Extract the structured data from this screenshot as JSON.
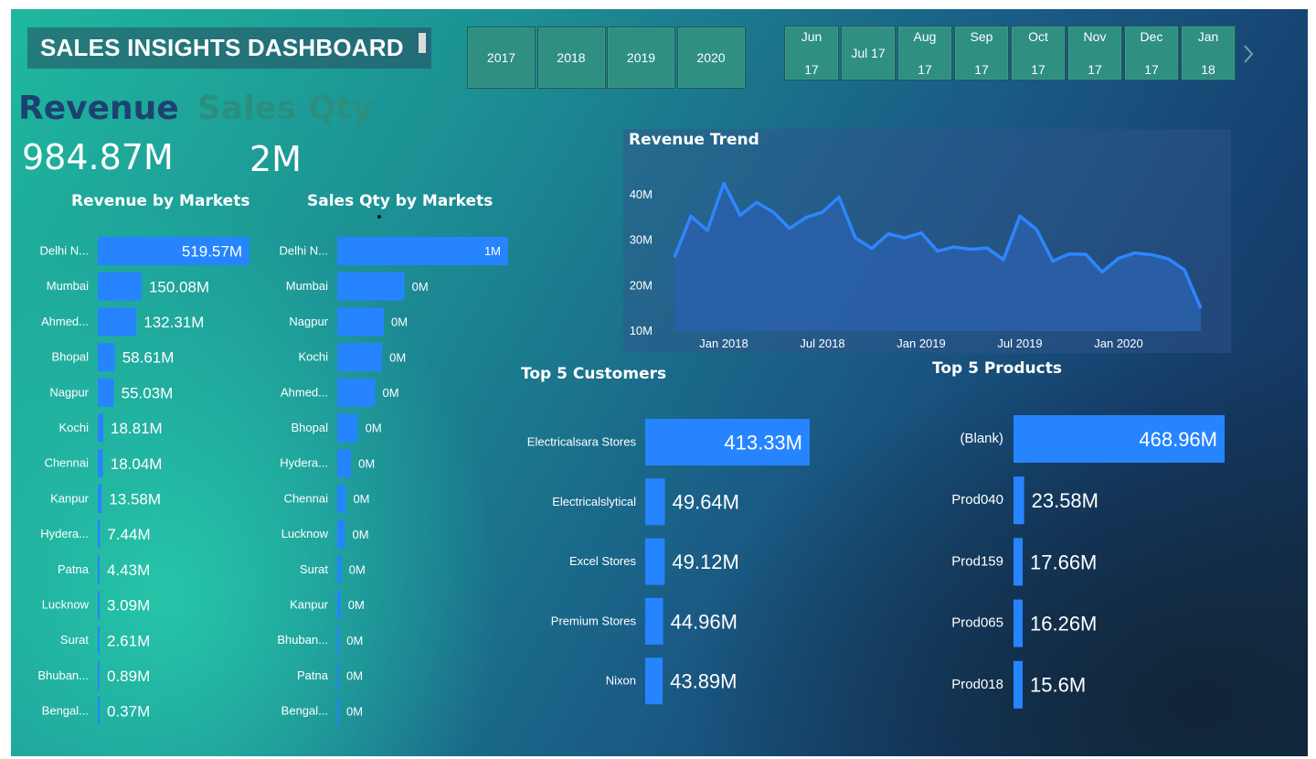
{
  "title": "SALES INSIGHTS DASHBOARD",
  "year_slicer": [
    "2017",
    "2018",
    "2019",
    "2020"
  ],
  "month_slicer": [
    "Jun 17",
    "Jul 17",
    "Aug 17",
    "Sep 17",
    "Oct 17",
    "Nov 17",
    "Dec 17",
    "Jan 18"
  ],
  "kpis": {
    "revenue_label": "Revenue",
    "revenue_value": "984.87M",
    "qty_label": "Sales Qty",
    "qty_value": "2M"
  },
  "colors": {
    "bar": "#2684ff",
    "revenue_label": "#1c4272",
    "qty_label": "#2b8f80",
    "line": "#2e86ff",
    "area": "#2a5fa8"
  },
  "icons": {
    "month_next": "chevron-right-icon"
  },
  "chart_data": [
    {
      "type": "bar",
      "orientation": "horizontal",
      "title": "Revenue by Markets",
      "categories": [
        "Delhi N...",
        "Mumbai",
        "Ahmed...",
        "Bhopal",
        "Nagpur",
        "Kochi",
        "Chennai",
        "Kanpur",
        "Hydera...",
        "Patna",
        "Lucknow",
        "Surat",
        "Bhuban...",
        "Bengal..."
      ],
      "values": [
        519.57,
        150.08,
        132.31,
        58.61,
        55.03,
        18.81,
        18.04,
        13.58,
        7.44,
        4.43,
        3.09,
        2.61,
        0.89,
        0.37
      ],
      "labels": [
        "519.57M",
        "150.08M",
        "132.31M",
        "58.61M",
        "55.03M",
        "18.81M",
        "18.04M",
        "13.58M",
        "7.44M",
        "4.43M",
        "3.09M",
        "2.61M",
        "0.89M",
        "0.37M"
      ]
    },
    {
      "type": "bar",
      "orientation": "horizontal",
      "title": "Sales Qty by Markets",
      "categories": [
        "Delhi N...",
        "Mumbai",
        "Nagpur",
        "Kochi",
        "Ahmed...",
        "Bhopal",
        "Hydera...",
        "Chennai",
        "Lucknow",
        "Surat",
        "Kanpur",
        "Bhuban...",
        "Patna",
        "Bengal..."
      ],
      "values": [
        0.99,
        0.39,
        0.27,
        0.26,
        0.22,
        0.12,
        0.08,
        0.05,
        0.045,
        0.025,
        0.02,
        0.012,
        0.008,
        0.005
      ],
      "labels": [
        "1M",
        "0M",
        "0M",
        "0M",
        "0M",
        "0M",
        "0M",
        "0M",
        "0M",
        "0M",
        "0M",
        "0M",
        "0M",
        "0M"
      ]
    },
    {
      "type": "area",
      "title": "Revenue Trend",
      "x_ticks": [
        "Jan 2018",
        "Jul 2018",
        "Jan 2019",
        "Jul 2019",
        "Jan 2020"
      ],
      "y_ticks": [
        "10M",
        "20M",
        "30M",
        "40M"
      ],
      "ylim": [
        10,
        40
      ],
      "x": [
        "2017-10",
        "2017-11",
        "2017-12",
        "2018-01",
        "2018-02",
        "2018-03",
        "2018-04",
        "2018-05",
        "2018-06",
        "2018-07",
        "2018-08",
        "2018-09",
        "2018-10",
        "2018-11",
        "2018-12",
        "2019-01",
        "2019-02",
        "2019-03",
        "2019-04",
        "2019-05",
        "2019-06",
        "2019-07",
        "2019-08",
        "2019-09",
        "2019-10",
        "2019-11",
        "2019-12",
        "2020-01",
        "2020-02",
        "2020-03",
        "2020-04",
        "2020-05",
        "2020-06"
      ],
      "values": [
        26.2,
        35.3,
        32.1,
        42.5,
        35.5,
        38.3,
        36.2,
        32.6,
        35.0,
        36.2,
        39.5,
        30.5,
        28.2,
        31.4,
        30.5,
        31.6,
        27.6,
        28.5,
        28.0,
        28.3,
        25.7,
        35.3,
        32.4,
        25.4,
        27.0,
        26.9,
        23.0,
        26.0,
        27.2,
        26.8,
        25.9,
        23.5,
        15.0
      ]
    },
    {
      "type": "bar",
      "orientation": "horizontal",
      "title": "Top 5 Customers",
      "categories": [
        "Electricalsara Stores",
        "Electricalslytical",
        "Excel Stores",
        "Premium Stores",
        "Nixon"
      ],
      "values": [
        413.33,
        49.64,
        49.12,
        44.96,
        43.89
      ],
      "labels": [
        "413.33M",
        "49.64M",
        "49.12M",
        "44.96M",
        "43.89M"
      ]
    },
    {
      "type": "bar",
      "orientation": "horizontal",
      "title": "Top 5 Products",
      "categories": [
        "(Blank)",
        "Prod040",
        "Prod159",
        "Prod065",
        "Prod018"
      ],
      "values": [
        468.96,
        23.58,
        17.66,
        16.26,
        15.6
      ],
      "labels": [
        "468.96M",
        "23.58M",
        "17.66M",
        "16.26M",
        "15.6M"
      ]
    }
  ]
}
